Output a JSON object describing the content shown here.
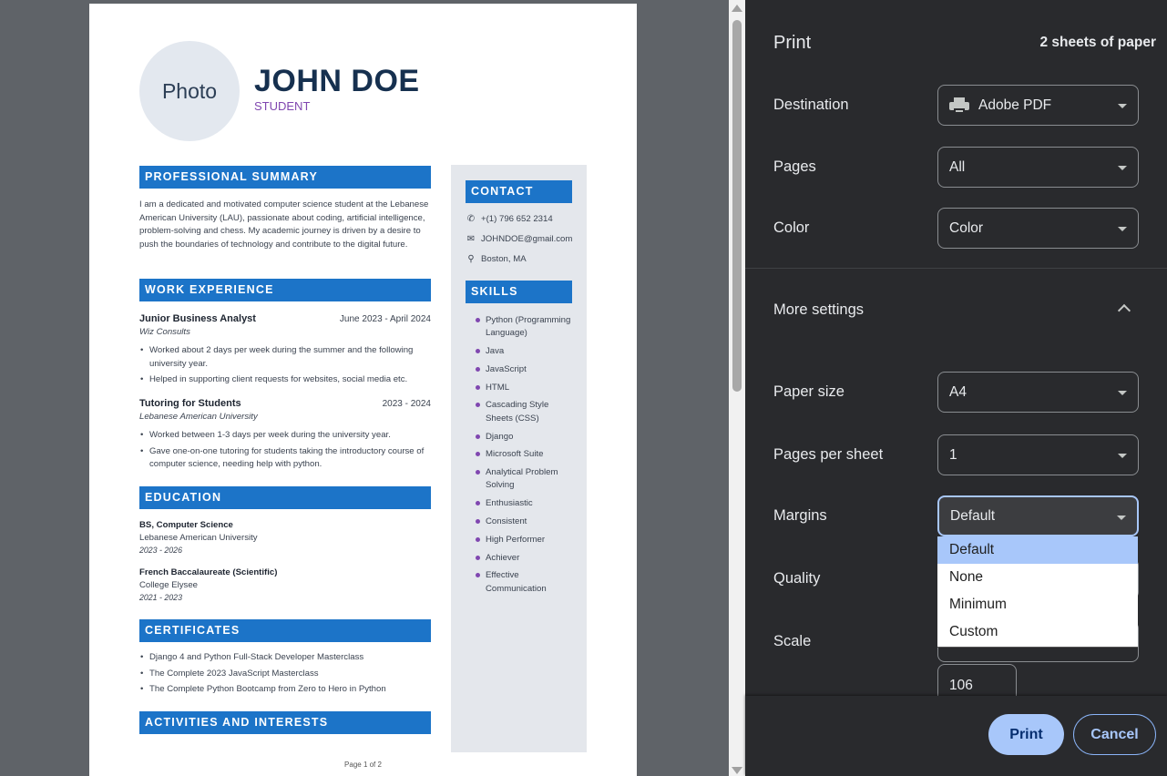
{
  "resume": {
    "photo_label": "Photo",
    "name": "JOHN DOE",
    "role": "STUDENT",
    "summary_head": "PROFESSIONAL SUMMARY",
    "summary": "I am a dedicated and motivated computer science student at the Lebanese American University (LAU), passionate about coding, artificial intelligence, problem-solving and chess. My academic journey is driven by a desire to push the boundaries of technology and contribute to the digital future.",
    "work_head": "WORK EXPERIENCE",
    "jobs": [
      {
        "title": "Junior Business Analyst",
        "date": "June 2023 - April 2024",
        "org": "Wiz Consults",
        "bullets": [
          "Worked about 2 days per week during the summer and the following university year.",
          "Helped in supporting client requests for websites, social media etc."
        ]
      },
      {
        "title": "Tutoring for Students",
        "date": "2023 - 2024",
        "org": "Lebanese American University",
        "bullets": [
          "Worked between 1-3 days per week during the university year.",
          "Gave one-on-one tutoring for students taking the introductory course of computer science, needing help with python."
        ]
      }
    ],
    "edu_head": "EDUCATION",
    "education": [
      {
        "degree": "BS, Computer Science",
        "school": "Lebanese American University",
        "years": "2023 - 2026"
      },
      {
        "degree": "French Baccalaureate (Scientific)",
        "school": "College Elysee",
        "years": "2021 - 2023"
      }
    ],
    "cert_head": "CERTIFICATES",
    "certificates": [
      "Django 4 and Python Full-Stack Developer Masterclass",
      "The Complete 2023 JavaScript Masterclass",
      "The Complete Python Bootcamp from Zero to Hero in Python"
    ],
    "activities_head": "ACTIVITIES AND INTERESTS",
    "contact_head": "CONTACT",
    "contact": {
      "phone": "+(1) 796 652 2314",
      "email": "JOHNDOE@gmail.com",
      "location": "Boston, MA"
    },
    "skills_head": "SKILLS",
    "skills": [
      "Python (Programming Language)",
      "Java",
      "JavaScript",
      "HTML",
      "Cascading Style Sheets (CSS)",
      "Django",
      "Microsoft Suite",
      "Analytical Problem Solving",
      "Enthusiastic",
      "Consistent",
      "High Performer",
      "Achiever",
      "Effective Communication"
    ],
    "page_label": "Page 1 of 2"
  },
  "print_panel": {
    "title": "Print",
    "sheets": "2 sheets of paper",
    "destination_label": "Destination",
    "destination_value": "Adobe PDF",
    "pages_label": "Pages",
    "pages_value": "All",
    "color_label": "Color",
    "color_value": "Color",
    "more_settings_label": "More settings",
    "paper_size_label": "Paper size",
    "paper_size_value": "A4",
    "pages_per_sheet_label": "Pages per sheet",
    "pages_per_sheet_value": "1",
    "margins_label": "Margins",
    "margins_value": "Default",
    "margin_options": [
      "Default",
      "None",
      "Minimum",
      "Custom"
    ],
    "quality_label": "Quality",
    "scale_label": "Scale",
    "scale_value": "106",
    "print_button": "Print",
    "cancel_button": "Cancel"
  },
  "colors": {
    "accent_blue": "#1c74c8",
    "name_navy": "#16304f",
    "role_purple": "#8047b0",
    "panel_bg": "#292a2d",
    "button_blue": "#a8c7fa"
  }
}
